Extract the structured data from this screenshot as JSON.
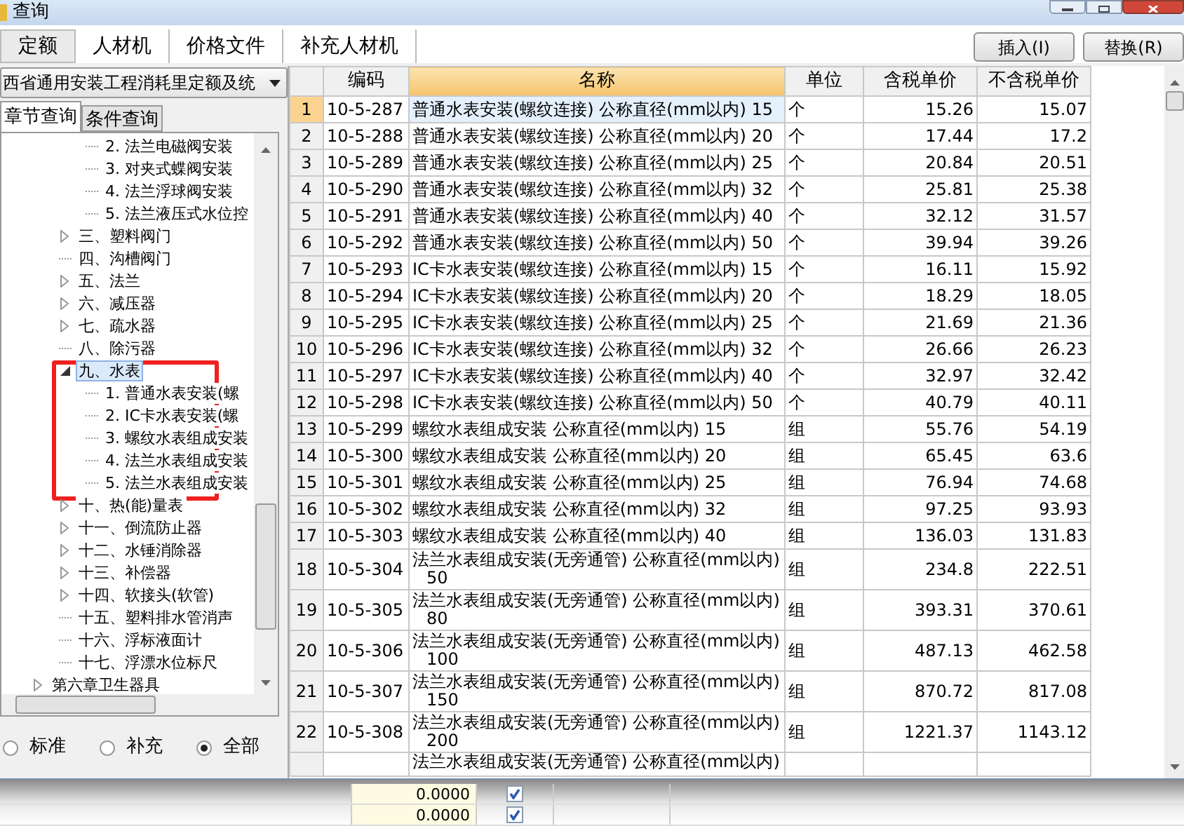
{
  "window": {
    "title": "查询"
  },
  "tabs": [
    {
      "label": "定额",
      "selected": true
    },
    {
      "label": "人材机",
      "selected": false
    },
    {
      "label": "价格文件",
      "selected": false
    },
    {
      "label": "补充人材机",
      "selected": false
    }
  ],
  "buttons": [
    "插入(I)",
    "替换(R)"
  ],
  "library_select": {
    "value": "西省通用安装工程消耗里定额及统"
  },
  "query_tabs": [
    {
      "label": "章节查询",
      "selected": true
    },
    {
      "label": "条件查询",
      "selected": false
    }
  ],
  "tree": {
    "nodes": [
      {
        "children": [
          {
            "children": [
              {
                "label": "2. 法兰电磁阀安装",
                "kind": "leaf",
                "selected": false
              },
              {
                "label": "3. 对夹式蝶阀安装",
                "kind": "leaf",
                "selected": false
              },
              {
                "label": "4. 法兰浮球阀安装",
                "kind": "leaf",
                "selected": false
              },
              {
                "label": "5. 法兰液压式水位控",
                "kind": "leaf",
                "selected": false
              }
            ]
          },
          {
            "label": "三、塑料阀门",
            "kind": "folder",
            "expanded": false,
            "selected": false
          },
          {
            "label": "四、沟槽阀门",
            "kind": "leaf",
            "selected": false
          },
          {
            "label": "五、法兰",
            "kind": "folder",
            "expanded": false,
            "selected": false
          },
          {
            "label": "六、减压器",
            "kind": "folder",
            "expanded": false,
            "selected": false
          },
          {
            "label": "七、疏水器",
            "kind": "folder",
            "expanded": false,
            "selected": false
          },
          {
            "label": "八、除污器",
            "kind": "leaf",
            "selected": false
          },
          {
            "label": "九、水表",
            "kind": "folder",
            "expanded": true,
            "selected": true,
            "children": [
              {
                "label": "1. 普通水表安装(螺",
                "kind": "leaf",
                "selected": false
              },
              {
                "label": "2. IC卡水表安装(螺",
                "kind": "leaf",
                "selected": false
              },
              {
                "label": "3. 螺纹水表组成安装",
                "kind": "leaf",
                "selected": false
              },
              {
                "label": "4. 法兰水表组成安装",
                "kind": "leaf",
                "selected": false
              },
              {
                "label": "5. 法兰水表组成安装",
                "kind": "leaf",
                "selected": false
              }
            ]
          },
          {
            "label": "十、热(能)量表",
            "kind": "folder",
            "expanded": false,
            "selected": false
          },
          {
            "label": "十一、倒流防止器",
            "kind": "folder",
            "expanded": false,
            "selected": false
          },
          {
            "label": "十二、水锤消除器",
            "kind": "folder",
            "expanded": false,
            "selected": false
          },
          {
            "label": "十三、补偿器",
            "kind": "folder",
            "expanded": false,
            "selected": false
          },
          {
            "label": "十四、软接头(软管)",
            "kind": "folder",
            "expanded": false,
            "selected": false
          },
          {
            "label": "十五、塑料排水管消声",
            "kind": "leaf",
            "selected": false
          },
          {
            "label": "十六、浮标液面计",
            "kind": "leaf",
            "selected": false
          },
          {
            "label": "十七、浮漂水位标尺",
            "kind": "leaf",
            "selected": false
          }
        ]
      },
      {
        "label": "第六章卫生器具",
        "kind": "folder",
        "expanded": false,
        "selected": false
      }
    ]
  },
  "filter": [
    {
      "label": "标准",
      "selected": false
    },
    {
      "label": "补充",
      "selected": false
    },
    {
      "label": "全部",
      "selected": true
    }
  ],
  "table": {
    "columns": [
      {
        "label": "编码",
        "selected": false
      },
      {
        "label": "名称",
        "selected": true
      },
      {
        "label": "单位",
        "selected": false
      },
      {
        "label": "含税单价",
        "selected": false
      },
      {
        "label": "不含税单价",
        "selected": false
      }
    ],
    "rows": [
      {
        "num": "1",
        "code": "10-5-287",
        "name": "普通水表安装(螺纹连接) 公称直径(mm以内) 15",
        "unit": "个",
        "tax": "15.26",
        "notax": "15.07",
        "kind": "single",
        "selected": true
      },
      {
        "num": "2",
        "code": "10-5-288",
        "name": "普通水表安装(螺纹连接) 公称直径(mm以内) 20",
        "unit": "个",
        "tax": "17.44",
        "notax": "17.2",
        "kind": "single",
        "selected": false
      },
      {
        "num": "3",
        "code": "10-5-289",
        "name": "普通水表安装(螺纹连接) 公称直径(mm以内) 25",
        "unit": "个",
        "tax": "20.84",
        "notax": "20.51",
        "kind": "single",
        "selected": false
      },
      {
        "num": "4",
        "code": "10-5-290",
        "name": "普通水表安装(螺纹连接) 公称直径(mm以内) 32",
        "unit": "个",
        "tax": "25.81",
        "notax": "25.38",
        "kind": "single",
        "selected": false
      },
      {
        "num": "5",
        "code": "10-5-291",
        "name": "普通水表安装(螺纹连接) 公称直径(mm以内) 40",
        "unit": "个",
        "tax": "32.12",
        "notax": "31.57",
        "kind": "single",
        "selected": false
      },
      {
        "num": "6",
        "code": "10-5-292",
        "name": "普通水表安装(螺纹连接) 公称直径(mm以内) 50",
        "unit": "个",
        "tax": "39.94",
        "notax": "39.26",
        "kind": "single",
        "selected": false
      },
      {
        "num": "7",
        "code": "10-5-293",
        "name": "IC卡水表安装(螺纹连接) 公称直径(mm以内) 15",
        "unit": "个",
        "tax": "16.11",
        "notax": "15.92",
        "kind": "single",
        "selected": false
      },
      {
        "num": "8",
        "code": "10-5-294",
        "name": "IC卡水表安装(螺纹连接) 公称直径(mm以内) 20",
        "unit": "个",
        "tax": "18.29",
        "notax": "18.05",
        "kind": "single",
        "selected": false
      },
      {
        "num": "9",
        "code": "10-5-295",
        "name": "IC卡水表安装(螺纹连接) 公称直径(mm以内) 25",
        "unit": "个",
        "tax": "21.69",
        "notax": "21.36",
        "kind": "single",
        "selected": false
      },
      {
        "num": "10",
        "code": "10-5-296",
        "name": "IC卡水表安装(螺纹连接) 公称直径(mm以内) 32",
        "unit": "个",
        "tax": "26.66",
        "notax": "26.23",
        "kind": "single",
        "selected": false
      },
      {
        "num": "11",
        "code": "10-5-297",
        "name": "IC卡水表安装(螺纹连接) 公称直径(mm以内) 40",
        "unit": "个",
        "tax": "32.97",
        "notax": "32.42",
        "kind": "single",
        "selected": false
      },
      {
        "num": "12",
        "code": "10-5-298",
        "name": "IC卡水表安装(螺纹连接) 公称直径(mm以内) 50",
        "unit": "个",
        "tax": "40.79",
        "notax": "40.11",
        "kind": "single",
        "selected": false
      },
      {
        "num": "13",
        "code": "10-5-299",
        "name": "螺纹水表组成安装 公称直径(mm以内) 15",
        "unit": "组",
        "tax": "55.76",
        "notax": "54.19",
        "kind": "single",
        "selected": false
      },
      {
        "num": "14",
        "code": "10-5-300",
        "name": "螺纹水表组成安装 公称直径(mm以内) 20",
        "unit": "组",
        "tax": "65.45",
        "notax": "63.6",
        "kind": "single",
        "selected": false
      },
      {
        "num": "15",
        "code": "10-5-301",
        "name": "螺纹水表组成安装 公称直径(mm以内) 25",
        "unit": "组",
        "tax": "76.94",
        "notax": "74.68",
        "kind": "single",
        "selected": false
      },
      {
        "num": "16",
        "code": "10-5-302",
        "name": "螺纹水表组成安装 公称直径(mm以内) 32",
        "unit": "组",
        "tax": "97.25",
        "notax": "93.93",
        "kind": "single",
        "selected": false
      },
      {
        "num": "17",
        "code": "10-5-303",
        "name": "螺纹水表组成安装 公称直径(mm以内) 40",
        "unit": "组",
        "tax": "136.03",
        "notax": "131.83",
        "kind": "single",
        "selected": false
      },
      {
        "num": "18",
        "code": "10-5-304",
        "name": "法兰水表组成安装(无旁通管) 公称直径(mm以内) 50",
        "unit": "组",
        "tax": "234.8",
        "notax": "222.51",
        "kind": "wrapped",
        "selected": false
      },
      {
        "num": "19",
        "code": "10-5-305",
        "name": "法兰水表组成安装(无旁通管) 公称直径(mm以内) 80",
        "unit": "组",
        "tax": "393.31",
        "notax": "370.61",
        "kind": "wrapped",
        "selected": false
      },
      {
        "num": "20",
        "code": "10-5-306",
        "name": "法兰水表组成安装(无旁通管) 公称直径(mm以内) 100",
        "unit": "组",
        "tax": "487.13",
        "notax": "462.58",
        "kind": "wrapped",
        "selected": false
      },
      {
        "num": "21",
        "code": "10-5-307",
        "name": "法兰水表组成安装(无旁通管) 公称直径(mm以内) 150",
        "unit": "组",
        "tax": "870.72",
        "notax": "817.08",
        "kind": "wrapped",
        "selected": false
      },
      {
        "num": "22",
        "code": "10-5-308",
        "name": "法兰水表组成安装(无旁通管) 公称直径(mm以内) 200",
        "unit": "组",
        "tax": "1221.37",
        "notax": "1143.12",
        "kind": "wrapped",
        "selected": false
      },
      {
        "name": "法兰水表组成安装(无旁通管) 公称直径(mm以内)",
        "kind": "cut",
        "selected": false
      }
    ]
  },
  "background_rows": [
    {
      "value": "0.0000",
      "checked": true
    },
    {
      "value": "0.0000",
      "checked": true
    }
  ]
}
